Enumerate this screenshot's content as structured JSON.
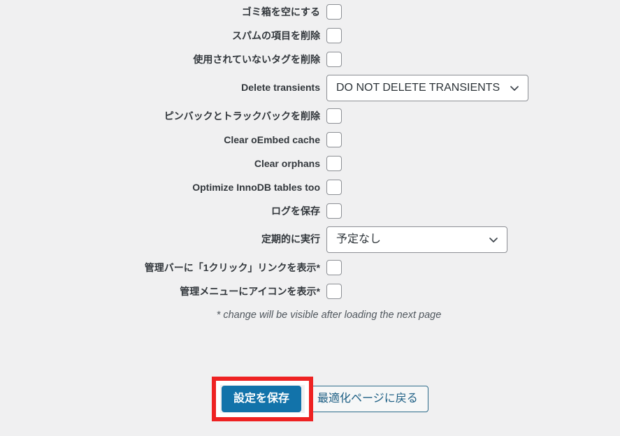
{
  "settings_form": {
    "rows": [
      {
        "label": "ゴミ箱を空にする",
        "control": "checkbox",
        "checked": false
      },
      {
        "label": "スパムの項目を削除",
        "control": "checkbox",
        "checked": false
      },
      {
        "label": "使用されていないタグを削除",
        "control": "checkbox",
        "checked": false
      },
      {
        "label": "Delete transients",
        "control": "select",
        "value": "DO NOT DELETE TRANSIENTS"
      },
      {
        "label": "ピンバックとトラックバックを削除",
        "control": "checkbox",
        "checked": false
      },
      {
        "label": "Clear oEmbed cache",
        "control": "checkbox",
        "checked": false
      },
      {
        "label": "Clear orphans",
        "control": "checkbox",
        "checked": false
      },
      {
        "label": "Optimize InnoDB tables too",
        "control": "checkbox",
        "checked": false
      },
      {
        "label": "ログを保存",
        "control": "checkbox",
        "checked": false
      },
      {
        "label": "定期的に実行",
        "control": "select",
        "value": "予定なし"
      },
      {
        "label": "管理バーに「1クリック」リンクを表示*",
        "control": "checkbox",
        "checked": false
      },
      {
        "label": "管理メニューにアイコンを表示*",
        "control": "checkbox",
        "checked": false
      }
    ],
    "footnote": "* change will be visible after loading the next page"
  },
  "actions": {
    "save_label": "設定を保存",
    "back_label": "最適化ページに戻る"
  },
  "colors": {
    "page_background": "#f0f0f1",
    "primary_button": "#1273aa",
    "secondary_button_text": "#1d5f84",
    "label_text": "#32373c",
    "highlight": "#ee2222"
  },
  "icons": {
    "chevron": "chevron-down-icon"
  }
}
